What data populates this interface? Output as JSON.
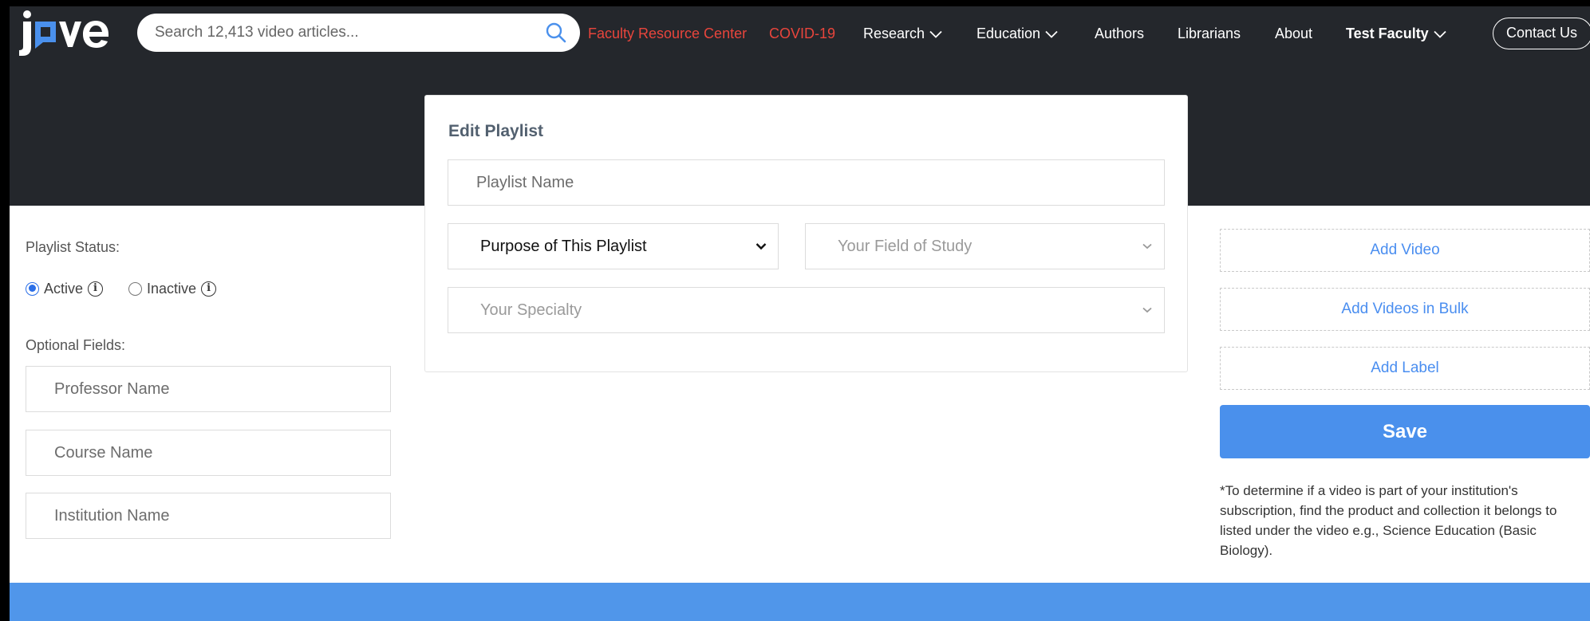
{
  "header": {
    "search_placeholder": "Search 12,413 video articles...",
    "nav": {
      "faculty_resource_center": "Faculty Resource Center",
      "covid": "COVID-19",
      "research": "Research",
      "education": "Education",
      "authors": "Authors",
      "librarians": "Librarians",
      "about": "About",
      "user": "Test Faculty",
      "contact": "Contact Us"
    },
    "accent_red": "#e8453c"
  },
  "left": {
    "status_label": "Playlist Status:",
    "active_label": "Active",
    "inactive_label": "Inactive",
    "selected_status": "Active",
    "optional_label": "Optional Fields:",
    "professor_placeholder": "Professor Name",
    "course_placeholder": "Course Name",
    "institution_placeholder": "Institution Name"
  },
  "card": {
    "title": "Edit Playlist",
    "playlist_name_placeholder": "Playlist Name",
    "purpose": "Purpose of This Playlist",
    "field_of_study": "Your Field of Study",
    "specialty": "Your Specialty"
  },
  "right": {
    "add_video": "Add Video",
    "add_bulk": "Add Videos in Bulk",
    "add_label": "Add Label",
    "save": "Save",
    "note": "*To determine if a video is part of your institution's subscription, find the product and collection it belongs to listed under the video e.g., Science Education (Basic Biology)."
  },
  "colors": {
    "header_bg": "#24272c",
    "primary_blue": "#4a90ec",
    "link_blue": "#4a8ef0",
    "footer_blue": "#5096ea"
  }
}
